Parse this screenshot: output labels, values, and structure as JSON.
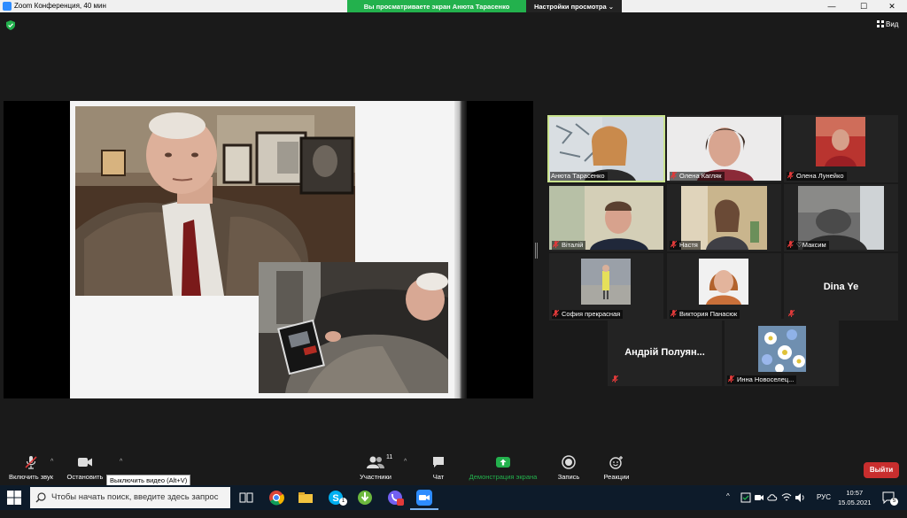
{
  "window": {
    "title": "Zoom Конференция, 40 мин",
    "controls": {
      "minimize": "—",
      "maximize": "☐",
      "close": "✕"
    }
  },
  "share_banner": {
    "viewing": "Вы просматриваете экран Анюта Тарасенко",
    "view_options": "Настройки просмотра"
  },
  "view_button": "Вид",
  "participants": [
    {
      "name": "Анюта Тарасенко",
      "muted": false,
      "active": true
    },
    {
      "name": "Олена Кагляк",
      "muted": true
    },
    {
      "name": "Олена Лунейко",
      "muted": true
    },
    {
      "name": "Віталій",
      "muted": true
    },
    {
      "name": "Настя",
      "muted": true
    },
    {
      "name": "Максим",
      "muted": true
    },
    {
      "name": "София прекрасная",
      "muted": true
    },
    {
      "name": "Виктория Панасюк",
      "muted": true
    },
    {
      "name": "Dina Ye",
      "muted": true,
      "video": false
    },
    {
      "name": "Андрій Полуян...",
      "muted": true,
      "video": false
    },
    {
      "name": "Инна Новоселец...",
      "muted": true
    }
  ],
  "toolbar": {
    "unmute": "Включить звук",
    "stop_video": "Остановить",
    "participants": "Участники",
    "participants_count": "11",
    "chat": "Чат",
    "share": "Демонстрация экрана",
    "record": "Запись",
    "reactions": "Реакции",
    "leave": "Выйти",
    "tooltip": "Выключить видео (Alt+V)"
  },
  "taskbar": {
    "search_placeholder": "Чтобы начать поиск, введите здесь запрос",
    "language": "РУС",
    "time": "10:57",
    "date": "15.05.2021",
    "skype_badge": "1",
    "notifications": "5"
  },
  "colors": {
    "share_green": "#23b14d",
    "active_speaker": "#c9e38d",
    "leave_red": "#c82e2e",
    "muted_red": "#e03a3a"
  }
}
